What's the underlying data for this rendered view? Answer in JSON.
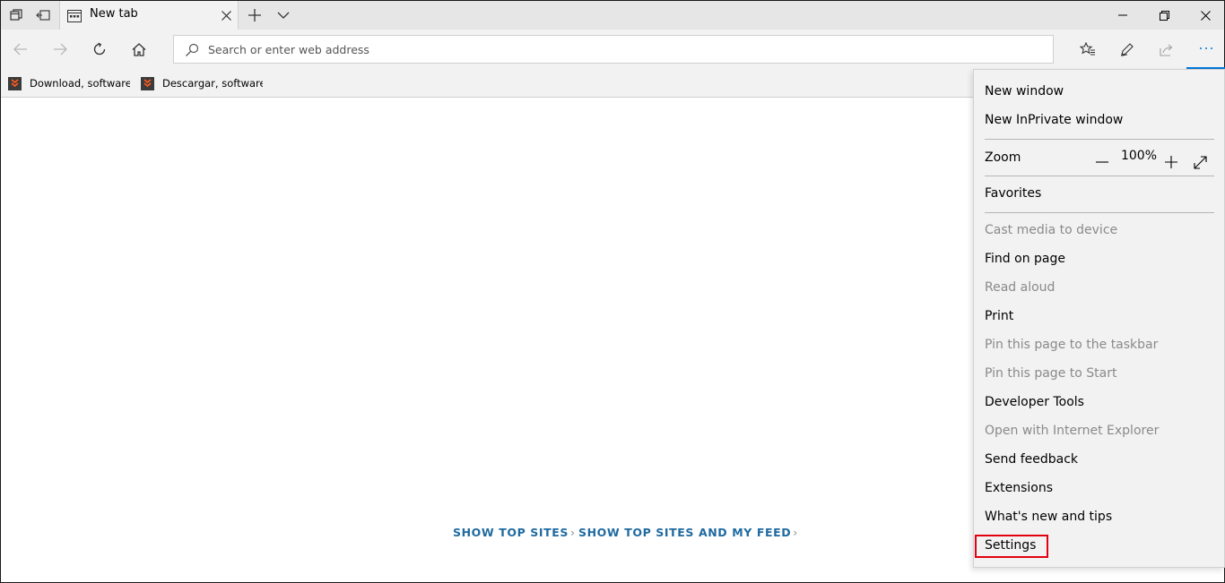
{
  "tabbar": {
    "tab_title": "New tab"
  },
  "navbar": {
    "address_placeholder": "Search or enter web address"
  },
  "favorites": [
    {
      "label": "Download, software, d"
    },
    {
      "label": "Descargar, software, d"
    }
  ],
  "content": {
    "show_top_sites": "SHOW TOP SITES",
    "show_top_sites_and_feed": "SHOW TOP SITES AND MY FEED"
  },
  "menu": {
    "new_window": "New window",
    "new_inprivate_window": "New InPrivate window",
    "zoom_label": "Zoom",
    "zoom_value": "100%",
    "favorites": "Favorites",
    "cast_media": "Cast media to device",
    "find_on_page": "Find on page",
    "read_aloud": "Read aloud",
    "print": "Print",
    "pin_taskbar": "Pin this page to the taskbar",
    "pin_start": "Pin this page to Start",
    "developer_tools": "Developer Tools",
    "open_ie": "Open with Internet Explorer",
    "send_feedback": "Send feedback",
    "extensions": "Extensions",
    "whats_new": "What's new and tips",
    "settings": "Settings"
  },
  "colors": {
    "accent": "#0078d7",
    "link": "#1f6aa0",
    "highlight_box": "#e3000f"
  }
}
